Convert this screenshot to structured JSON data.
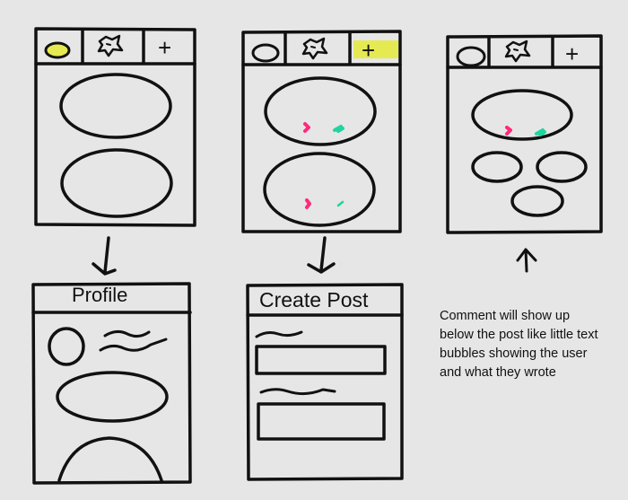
{
  "screens": {
    "profile": {
      "title": "Profile"
    },
    "create_post": {
      "title": "Create Post"
    }
  },
  "tabs": {
    "plus_glyph": "+"
  },
  "note": {
    "lines": [
      "Comment will show up",
      "below the post like little text",
      "bubbles showing the user",
      "and what they wrote"
    ]
  },
  "colors": {
    "background": "#e6e6e6",
    "ink": "#111111",
    "highlight": "#e6ea52",
    "like_mark": "#ff2a7a",
    "comment_mark": "#1fd4a0"
  },
  "icons": {
    "tab_1": "profile-circle-icon",
    "tab_2": "home-icon",
    "tab_3": "plus-icon",
    "arrows": "arrow-icon"
  }
}
